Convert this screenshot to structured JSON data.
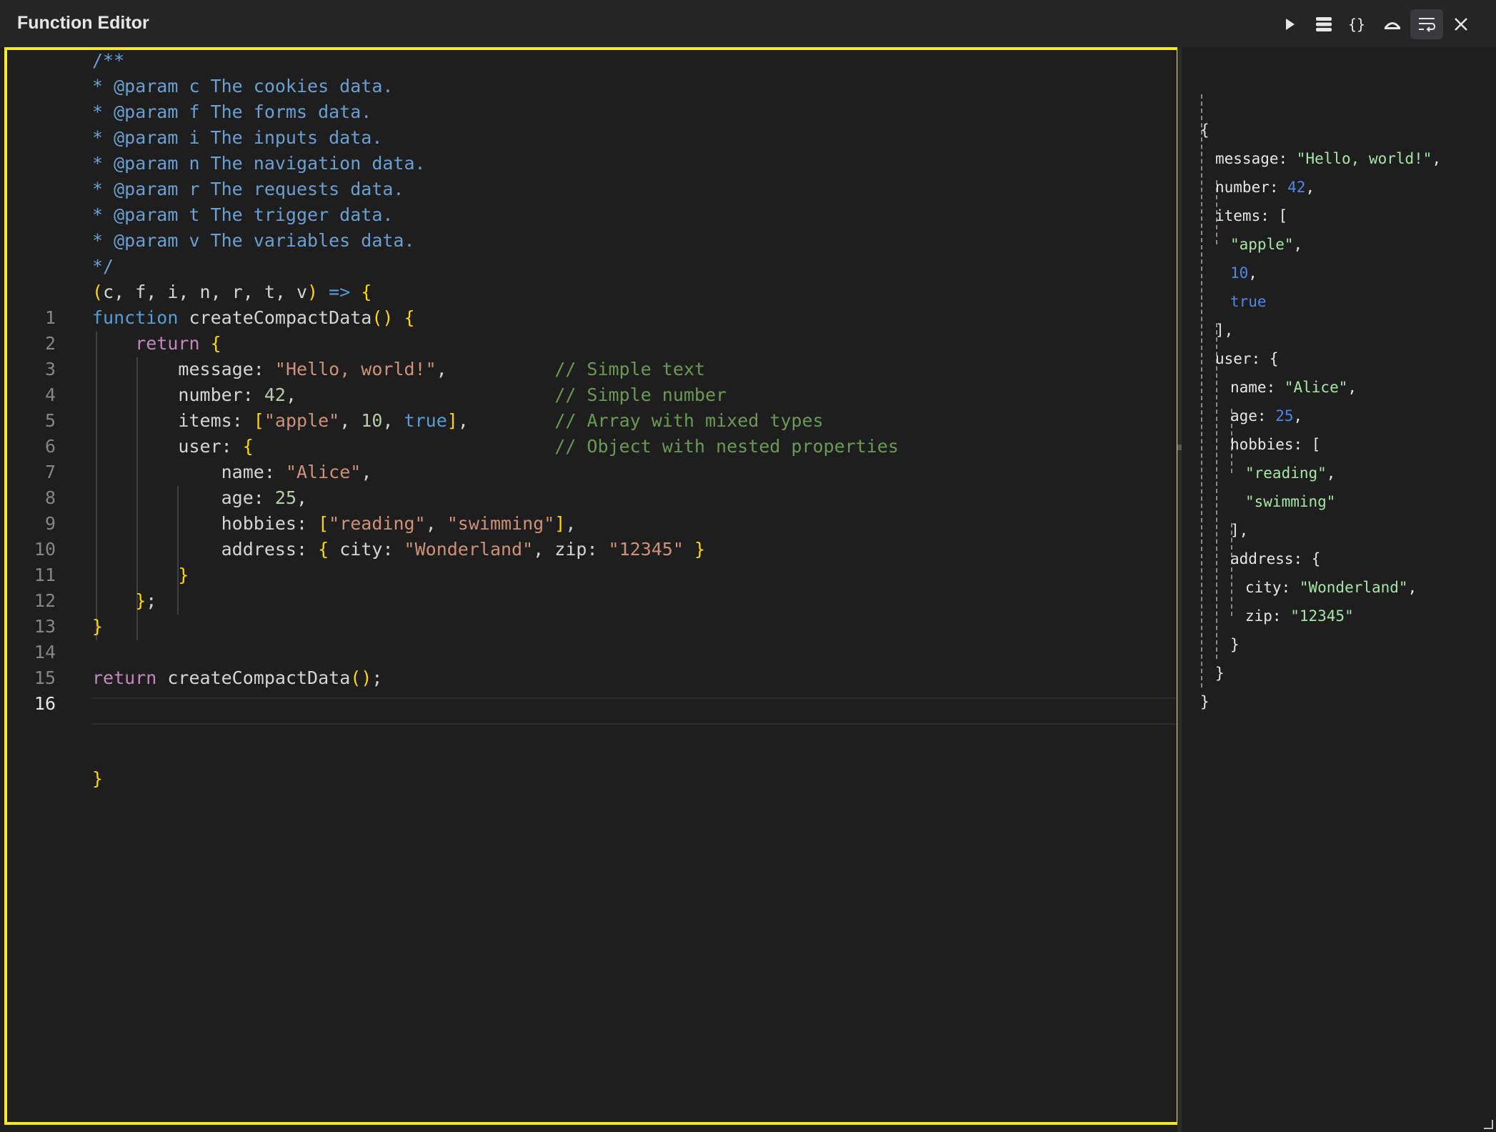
{
  "window": {
    "title": "Function Editor"
  },
  "toolbar": {
    "run": "play-icon",
    "layers": "layers-icon",
    "format": "braces-icon",
    "fold": "fold-icon",
    "wrap": "word-wrap-icon",
    "close": "close-icon"
  },
  "editor": {
    "highlight_color": "#f4ea2a",
    "header_lines": [
      "/**",
      "* @param c The cookies data.",
      "* @param f The forms data.",
      "* @param i The inputs data.",
      "* @param n The navigation data.",
      "* @param r The requests data.",
      "* @param t The trigger data.",
      "* @param v The variables data.",
      "*/",
      "(c, f, i, n, r, t, v) => {"
    ],
    "line_numbers": [
      "1",
      "2",
      "3",
      "4",
      "5",
      "6",
      "7",
      "8",
      "9",
      "10",
      "11",
      "12",
      "13",
      "14",
      "15",
      "16"
    ],
    "current_line": "16",
    "code_lines": [
      "function createCompactData() {",
      "    return {",
      "        message: \"Hello, world!\",          // Simple text",
      "        number: 42,                        // Simple number",
      "        items: [\"apple\", 10, true],        // Array with mixed types",
      "        user: {                            // Object with nested properties",
      "            name: \"Alice\",",
      "            age: 25,",
      "            hobbies: [\"reading\", \"swimming\"],",
      "            address: { city: \"Wonderland\", zip: \"12345\" }",
      "        }",
      "    };",
      "}",
      "",
      "return createCompactData();",
      ""
    ],
    "footer_line": "}"
  },
  "output": {
    "lines": [
      "{",
      "message: \"Hello, world!\",",
      "number: 42,",
      "items: [",
      "\"apple\",",
      "10,",
      "true",
      "],",
      "user: {",
      "name: \"Alice\",",
      "age: 25,",
      "hobbies: [",
      "\"reading\",",
      "\"swimming\"",
      "],",
      "address: {",
      "city: \"Wonderland\",",
      "zip: \"12345\"",
      "}",
      "}",
      "}"
    ]
  }
}
